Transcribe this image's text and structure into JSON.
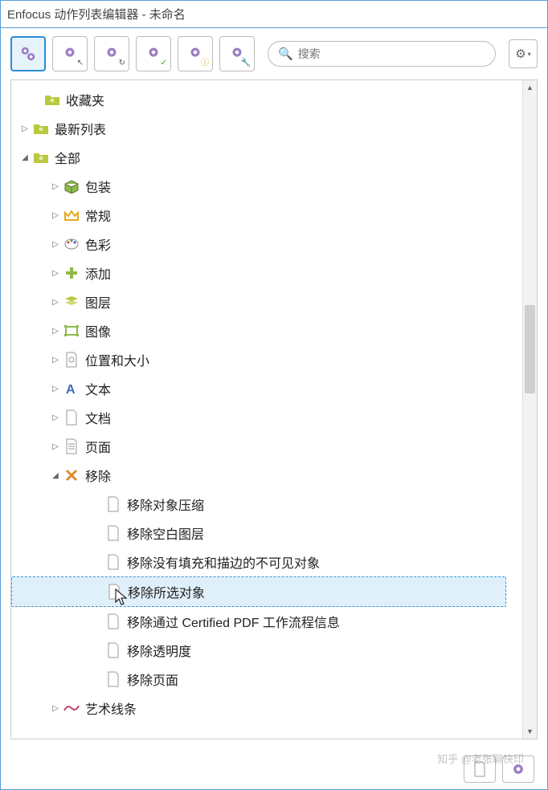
{
  "window": {
    "title": "Enfocus 动作列表编辑器 - 未命名"
  },
  "search": {
    "placeholder": "搜索"
  },
  "tree": {
    "favorites": "收藏夹",
    "recent": "最新列表",
    "all": "全部",
    "packaging": "包装",
    "general": "常规",
    "color": "色彩",
    "add": "添加",
    "layers": "图层",
    "image": "图像",
    "position_size": "位置和大小",
    "text": "文本",
    "document": "文档",
    "page": "页面",
    "remove": "移除",
    "remove_children": {
      "compression": "移除对象压缩",
      "empty_layers": "移除空白图层",
      "invisible": "移除没有填充和描边的不可见对象",
      "selected": "移除所选对象",
      "certified": "移除通过 Certified PDF 工作流程信息",
      "transparency": "移除透明度",
      "remove_page": "移除页面"
    },
    "art_lines": "艺术线条"
  },
  "watermark": "知乎 @老张聊快印"
}
